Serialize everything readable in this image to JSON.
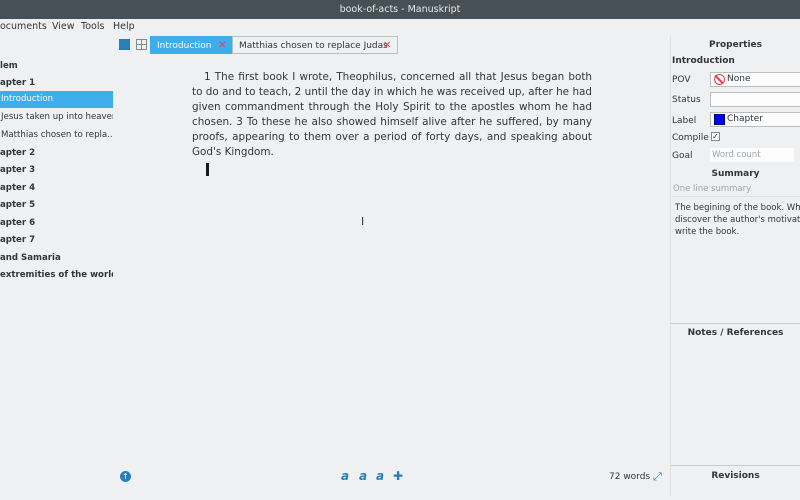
{
  "window": {
    "title": "book-of-acts - Manuskript"
  },
  "menu": [
    {
      "label": "ocuments"
    },
    {
      "label": "View"
    },
    {
      "label": "Tools"
    },
    {
      "label": "Help"
    }
  ],
  "outline": {
    "items": [
      {
        "label": "lem",
        "bold": true
      },
      {
        "label": "apter 1",
        "bold": true
      },
      {
        "label": "Introduction",
        "selected": true
      },
      {
        "label": "Jesus taken up into heaven"
      },
      {
        "label": "Matthias chosen to repla..."
      },
      {
        "label": "apter 2",
        "bold": true
      },
      {
        "label": "apter 3",
        "bold": true
      },
      {
        "label": "apter 4",
        "bold": true
      },
      {
        "label": "apter 5",
        "bold": true
      },
      {
        "label": "apter 6",
        "bold": true
      },
      {
        "label": "apter 7",
        "bold": true
      },
      {
        "label": "and Samaria",
        "bold": true
      },
      {
        "label": "extremities of the world",
        "bold": true
      }
    ]
  },
  "tabs": [
    {
      "label": "Introduction",
      "close": "✕",
      "active": true
    },
    {
      "label": "Matthias chosen to replace Judas",
      "close": "✕",
      "active": false
    }
  ],
  "editor": {
    "text": "1 The first book I wrote, Theophilus, concerned all that Jesus began both to do and to teach, 2 until the day in which he was received up, after he had given commandment through the Holy Spirit to the apostles whom he had chosen. 3 To these he also showed himself alive after he suffered, by many proofs, appearing to them over a period of forty days, and speaking about God's Kingdom."
  },
  "statusbar": {
    "word_count": "72 words",
    "format_icons": [
      "a",
      "a",
      "a"
    ]
  },
  "properties": {
    "header": "Properties",
    "item_title": "Introduction",
    "pov_label": "POV",
    "pov_value": "None",
    "status_label": "Status",
    "status_value": "",
    "label_label": "Label",
    "label_value": "Chapter",
    "label_color": "#0000ee",
    "compile_label": "Compile",
    "compile_checked": "✓",
    "goal_label": "Goal",
    "goal_placeholder": "Word count",
    "summary_header": "Summary",
    "summary_placeholder": "One line summary",
    "summary_lines": [
      "The begining of the book. Whe",
      "discover the author's motivatio",
      "write the book."
    ],
    "notes_header": "Notes / References",
    "revisions_header": "Revisions"
  },
  "colors": {
    "accent": "#3daee9",
    "close": "#da4453",
    "icon_blue": "#2980b9"
  }
}
